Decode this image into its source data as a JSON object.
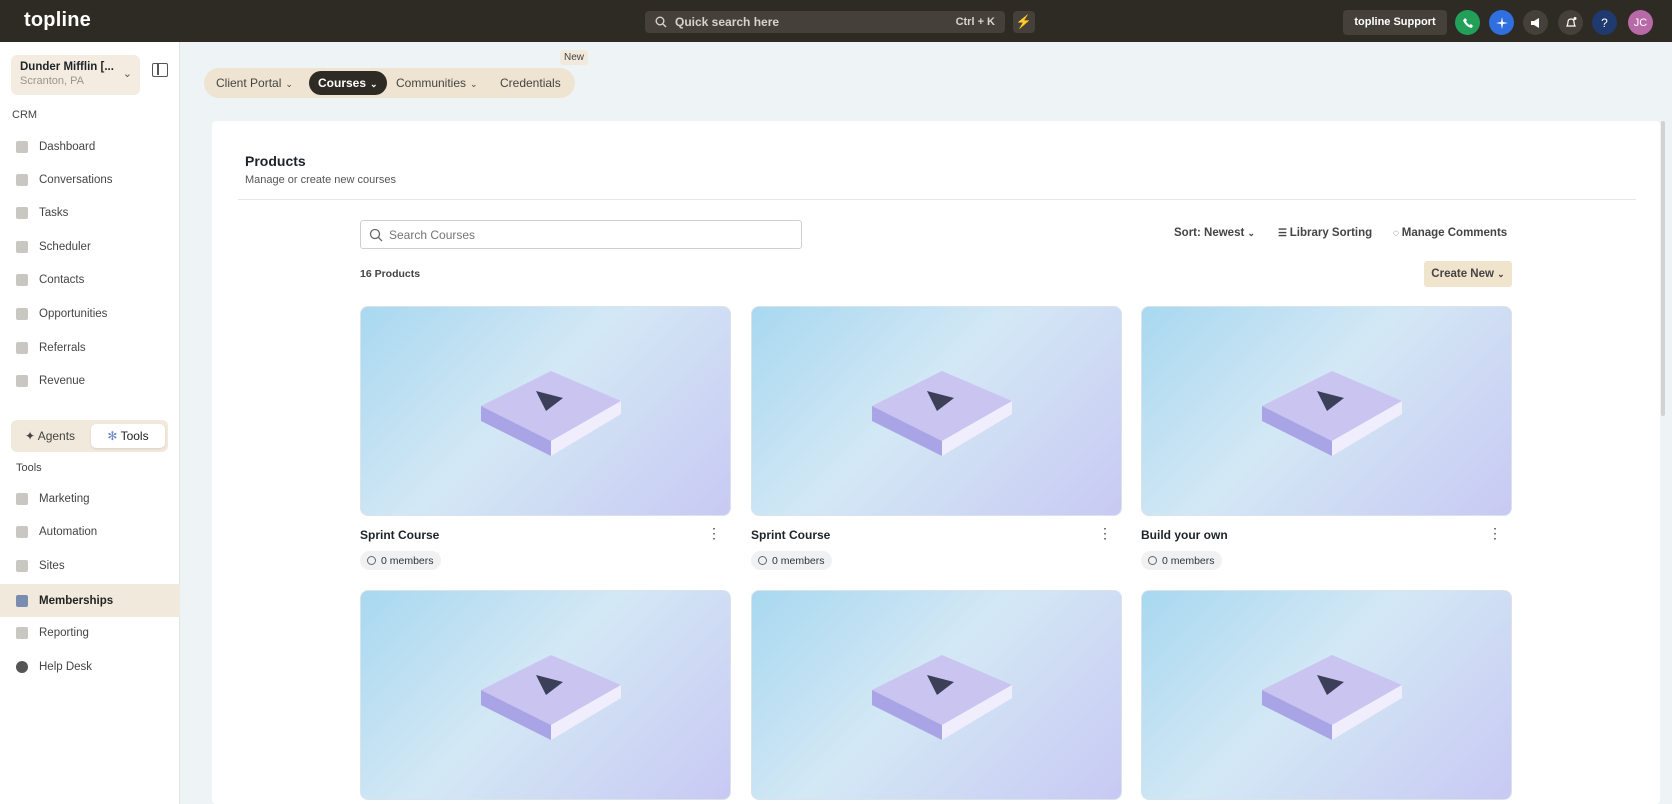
{
  "app": {
    "logo": "topline"
  },
  "topbar": {
    "search_placeholder": "Quick search here",
    "shortcut": "Ctrl + K",
    "bolt_icon": "⚡",
    "support_label": "topline Support",
    "avatar_initials": "JC",
    "help_icon": "?"
  },
  "account": {
    "name": "Dunder Mifflin [...",
    "location": "Scranton, PA"
  },
  "sidebar": {
    "crm_label": "CRM",
    "crm_items": [
      {
        "label": "Dashboard"
      },
      {
        "label": "Conversations"
      },
      {
        "label": "Tasks"
      },
      {
        "label": "Scheduler"
      },
      {
        "label": "Contacts"
      },
      {
        "label": "Opportunities"
      },
      {
        "label": "Referrals"
      },
      {
        "label": "Revenue"
      }
    ],
    "segment": {
      "agents": "Agents",
      "tools": "Tools"
    },
    "tools_label": "Tools",
    "tool_items": [
      {
        "label": "Marketing"
      },
      {
        "label": "Automation"
      },
      {
        "label": "Sites"
      },
      {
        "label": "Memberships"
      },
      {
        "label": "Reporting"
      },
      {
        "label": "Help Desk"
      }
    ]
  },
  "tabs": {
    "new_badge": "New",
    "items": [
      {
        "label": "Client Portal"
      },
      {
        "label": "Courses"
      },
      {
        "label": "Communities"
      },
      {
        "label": "Credentials"
      }
    ]
  },
  "page": {
    "title": "Products",
    "subtitle": "Manage or create new courses",
    "search_placeholder": "Search Courses",
    "sort_label": "Sort: Newest",
    "library_sorting": "Library Sorting",
    "manage_comments": "Manage Comments",
    "count": "16 Products",
    "create_label": "Create New"
  },
  "courses": [
    {
      "title": "Sprint Course",
      "members": "0 members"
    },
    {
      "title": "Sprint Course",
      "members": "0 members"
    },
    {
      "title": "Build your own",
      "members": "0 members"
    },
    {
      "title": "",
      "members": ""
    },
    {
      "title": "",
      "members": ""
    },
    {
      "title": "",
      "members": ""
    }
  ],
  "colors": {
    "topbar": "#2e2a24",
    "accent_cream": "#f1e9dc",
    "phone_green": "#22a05a",
    "ai_blue": "#2f6fe0"
  }
}
